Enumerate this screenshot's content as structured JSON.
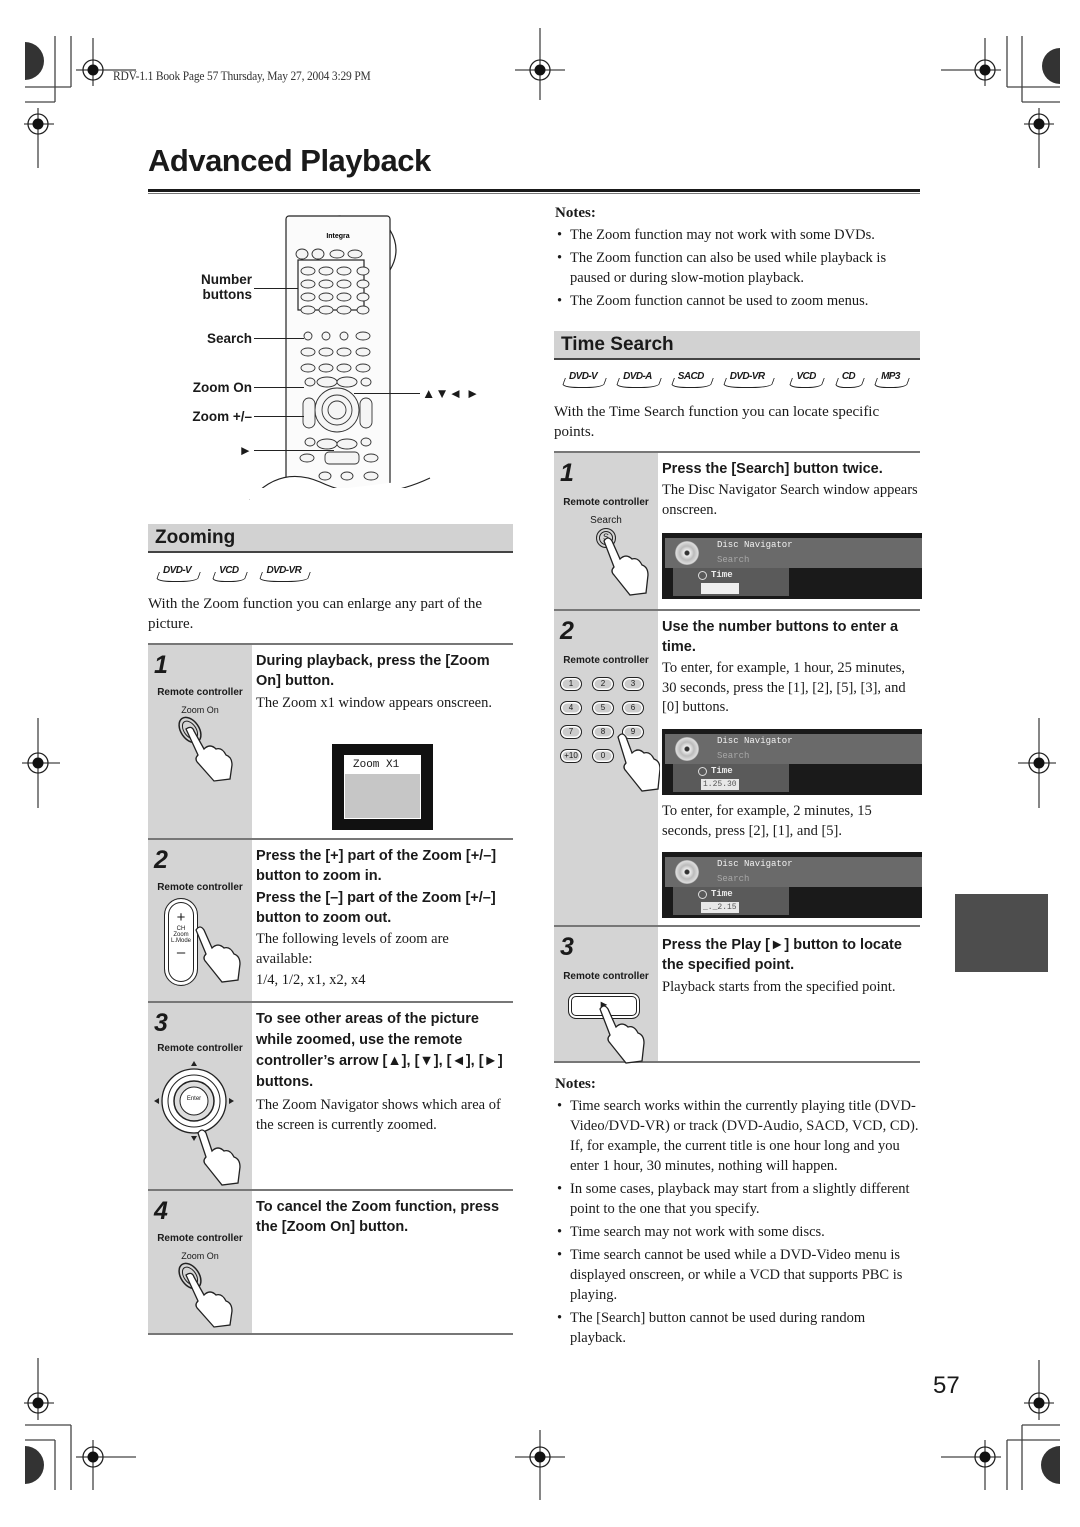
{
  "print_header": "RDV-1.1 Book Page 57 Thursday, May 27, 2004 3:29 PM",
  "page_title": "Advanced Playback",
  "page_number": "57",
  "remote_diagram": {
    "brand": "Integra",
    "callouts": {
      "number_buttons": "Number buttons",
      "search": "Search",
      "zoom_on": "Zoom On",
      "zoom_plus_minus": "Zoom +/–",
      "play": "►",
      "arrows": "▲▼◄ ►"
    }
  },
  "zooming": {
    "title": "Zooming",
    "discs": [
      "DVD-V",
      "VCD",
      "DVD-VR"
    ],
    "intro": "With the Zoom function you can enlarge any part of the picture.",
    "steps": [
      {
        "num": "1",
        "rc_label": "Remote controller",
        "rc_button": "Zoom On",
        "heading": "During playback, press the [Zoom On] button.",
        "body": "The Zoom x1 window appears onscreen.",
        "osd": "Zoom X1"
      },
      {
        "num": "2",
        "rc_label": "Remote controller",
        "rc_button_lines": [
          "+",
          "CH",
          "Zoom",
          "L.Mode",
          "–"
        ],
        "heading1": "Press the [+] part of the Zoom [+/–] button to zoom in.",
        "heading2": "Press the [–] part of the Zoom [+/–] button to zoom out.",
        "body": "The following levels of zoom are available:",
        "levels": "1/4, 1/2, x1, x2, x4"
      },
      {
        "num": "3",
        "rc_label": "Remote controller",
        "rc_button": "Enter",
        "heading": "To see other areas of the picture while zoomed, use the remote controller’s arrow [▲], [▼], [◄], [►] buttons.",
        "body": "The Zoom Navigator shows which area of the screen is currently zoomed."
      },
      {
        "num": "4",
        "rc_label": "Remote controller",
        "rc_button": "Zoom On",
        "heading": "To cancel the Zoom function, press the [Zoom On] button."
      }
    ],
    "notes_title": "Notes:",
    "notes": [
      "The Zoom function may not work with some DVDs.",
      "The Zoom function can also be used while playback is paused or during slow-motion playback.",
      "The Zoom function cannot be used to zoom menus."
    ]
  },
  "time_search": {
    "title": "Time Search",
    "discs": [
      "DVD-V",
      "DVD-A",
      "SACD",
      "DVD-VR",
      "VCD",
      "CD",
      "MP3"
    ],
    "intro": "With the Time Search function you can locate specific points.",
    "osd": {
      "title": "Disc Navigator",
      "subtitle": "Search",
      "field_label": "Time",
      "values": [
        "",
        "1.25.30",
        "_._2.15"
      ]
    },
    "steps": [
      {
        "num": "1",
        "rc_label": "Remote controller",
        "rc_button": "Search",
        "rc_key": "S",
        "heading": "Press the [Search] button twice.",
        "body": "The Disc Navigator Search window appears onscreen."
      },
      {
        "num": "2",
        "rc_label": "Remote controller",
        "keypad": [
          "1",
          "2",
          "3",
          "4",
          "5",
          "6",
          "7",
          "8",
          "9",
          "+10",
          "0"
        ],
        "heading": "Use the number buttons to enter a time.",
        "body": "To enter, for example, 1 hour, 25 minutes, 30 seconds, press the [1], [2], [5], [3], and [0] buttons.",
        "body2": "To enter, for example, 2 minutes, 15 seconds, press [2], [1], and [5]."
      },
      {
        "num": "3",
        "rc_label": "Remote controller",
        "rc_button": "►",
        "heading": "Press the Play [►] button to locate the specified point.",
        "body": "Playback starts from the specified point."
      }
    ],
    "notes_title": "Notes:",
    "notes": [
      "Time search works within the currently playing title (DVD-Video/DVD-VR) or track (DVD-Audio, SACD, VCD, CD). If, for example, the current title is one hour long and you enter 1 hour, 30 minutes, nothing will happen.",
      "In some cases, playback may start from a slightly different point to the one that you specify.",
      "Time search may not work with some discs.",
      "Time search cannot be used while a DVD-Video menu is displayed onscreen, or while a VCD that supports PBC is playing.",
      "The [Search] button cannot be used during random playback."
    ]
  },
  "colors": {
    "section_header_bg": "#d2d2d2",
    "step_sidebar_bg": "#d4d4d4",
    "side_tab": "#4d4d4d",
    "osd_bg": "#1a1a1a"
  }
}
